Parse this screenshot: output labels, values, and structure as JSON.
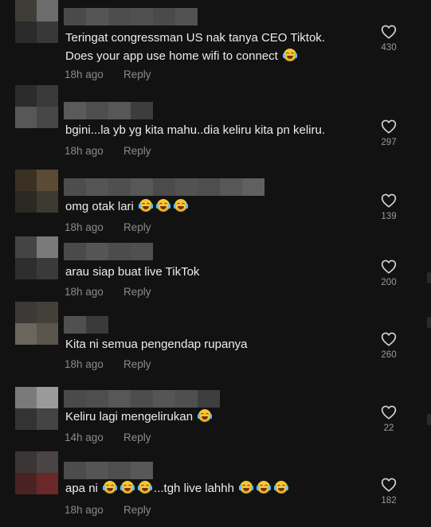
{
  "comments": [
    {
      "text_lines": [
        "Teringat congressman US nak tanya CEO Tiktok.",
        "Does your app use home wifi to connect"
      ],
      "emojis_after_text": 1,
      "emojis_mid": 0,
      "text_after_mid": "",
      "emojis_end": 0,
      "time": "18h ago",
      "reply": "Reply",
      "likes": "430",
      "avatar_colors": [
        "#3e3d38",
        "#6c6c6c",
        "#2a2a2a",
        "#383838"
      ],
      "name_colors": [
        "#4a4a4a",
        "#555555",
        "#4d4d4d",
        "#505050",
        "#4a4a4a",
        "#525252"
      ]
    },
    {
      "text_lines": [
        "bgini...la yb yg kita mahu..dia keliru kita pn keliru."
      ],
      "emojis_after_text": 0,
      "emojis_mid": 0,
      "text_after_mid": "",
      "emojis_end": 0,
      "time": "18h ago",
      "reply": "Reply",
      "likes": "297",
      "avatar_colors": [
        "#2c2c2c",
        "#3a3a3a",
        "#575757",
        "#474747"
      ],
      "name_colors": [
        "#5a5a5a",
        "#4e4e4e",
        "#575757",
        "#3d3d3d"
      ]
    },
    {
      "text_lines": [
        "omg otak lari"
      ],
      "emojis_after_text": 3,
      "emojis_mid": 0,
      "text_after_mid": "",
      "emojis_end": 0,
      "time": "18h ago",
      "reply": "Reply",
      "likes": "139",
      "avatar_colors": [
        "#3a3124",
        "#5c4b34",
        "#2b2a22",
        "#3c3a30"
      ],
      "name_colors": [
        "#4d4d4d",
        "#555555",
        "#4f4f4f",
        "#585858",
        "#4b4b4b",
        "#525252",
        "#4e4e4e",
        "#575757",
        "#606060"
      ]
    },
    {
      "text_lines": [
        "arau siap buat live TikTok"
      ],
      "emojis_after_text": 0,
      "emojis_mid": 0,
      "text_after_mid": "",
      "emojis_end": 0,
      "time": "18h ago",
      "reply": "Reply",
      "likes": "200",
      "avatar_colors": [
        "#444444",
        "#7a7a7a",
        "#2e2e2e",
        "#3a3a3a"
      ],
      "name_colors": [
        "#4a4a4a",
        "#555555",
        "#4c4c4c",
        "#505050"
      ]
    },
    {
      "text_lines": [
        "Kita ni semua pengendap rupanya"
      ],
      "emojis_after_text": 0,
      "emojis_mid": 0,
      "text_after_mid": "",
      "emojis_end": 0,
      "time": "18h ago",
      "reply": "Reply",
      "likes": "260",
      "avatar_colors": [
        "#3b3a36",
        "#434039",
        "#6b665b",
        "#5a564c"
      ],
      "name_colors": [
        "#505050",
        "#3a3a3a"
      ]
    },
    {
      "text_lines": [
        "Keliru lagi mengelirukan"
      ],
      "emojis_after_text": 1,
      "emojis_mid": 0,
      "text_after_mid": "",
      "emojis_end": 0,
      "time": "14h ago",
      "reply": "Reply",
      "likes": "22",
      "avatar_colors": [
        "#7a7a7a",
        "#9a9a9a",
        "#333333",
        "#444444"
      ],
      "name_colors": [
        "#4a4a4a",
        "#4e4e4e",
        "#575757",
        "#4d4d4d",
        "#555555",
        "#4f4f4f",
        "#3e3e3e"
      ]
    },
    {
      "text_lines": [
        "apa ni"
      ],
      "emojis_after_text": 0,
      "emojis_mid": 3,
      "text_after_mid": "...tgh live lahhh",
      "emojis_end": 3,
      "time": "18h ago",
      "reply": "Reply",
      "likes": "182",
      "avatar_colors": [
        "#3a3636",
        "#4a4444",
        "#4a2222",
        "#6a2828"
      ],
      "name_colors": [
        "#4c4c4c",
        "#555555",
        "#4e4e4e",
        "#585858"
      ]
    }
  ],
  "icons": {
    "like": "heart-outline-icon"
  },
  "colors": {
    "background": "#121212",
    "text": "#ececec",
    "meta": "#8b8b8b"
  }
}
